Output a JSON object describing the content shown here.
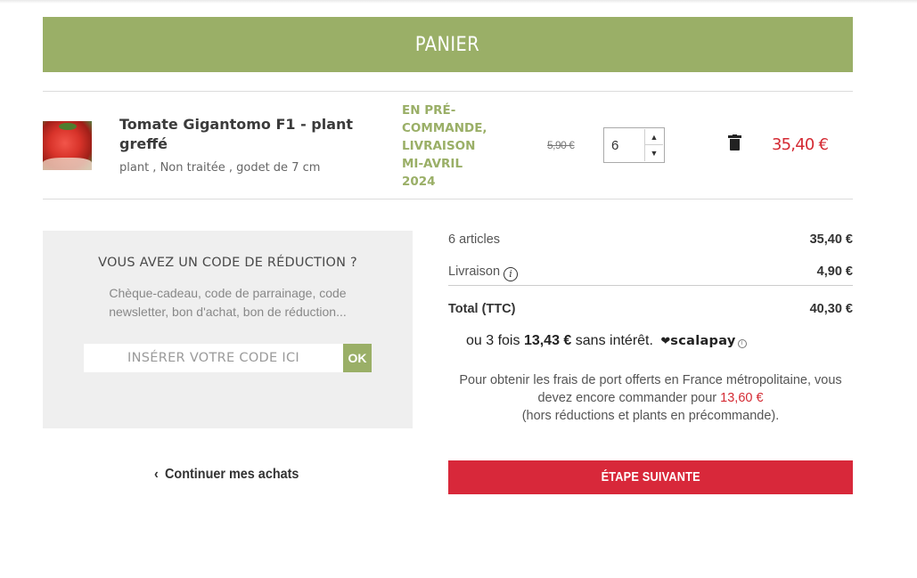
{
  "page": {
    "title": "PANIER"
  },
  "item": {
    "name": "Tomate Gigantomo F1 - plant greffé",
    "description": "plant , Non traitée , godet de 7 cm",
    "availability": "EN PRÉ-COMMANDE, LIVRAISON MI-AVRIL 2024",
    "unit_price": "5,90 €",
    "quantity": "6",
    "line_total": "35,40 €",
    "image_icon": "tomato-image"
  },
  "promo": {
    "title": "VOUS AVEZ UN CODE DE RÉDUCTION ?",
    "subtitle": "Chèque-cadeau, code de parrainage, code newsletter, bon d'achat, bon de réduction...",
    "placeholder": "INSÉRER VOTRE CODE ICI",
    "ok_label": "OK"
  },
  "summary": {
    "articles_label": "6 articles",
    "articles_amount": "35,40 €",
    "shipping_label": "Livraison",
    "shipping_amount": "4,90 €",
    "total_label": "Total (TTC)",
    "total_amount": "40,30 €"
  },
  "scalapay": {
    "prefix": "ou 3 fois",
    "amount": "13,43 €",
    "suffix": "sans intérêt.",
    "brand": "scalapay"
  },
  "free_shipping": {
    "text_before": "Pour obtenir les frais de port offerts en France métropolitaine, vous devez encore commander pour",
    "amount": "13,60 €",
    "text_after": "(hors réductions et plants en précommande)."
  },
  "actions": {
    "continue_label": "Continuer mes achats",
    "next_label": "ÉTAPE SUIVANTE"
  },
  "colors": {
    "accent_green": "#9aaf67",
    "accent_red": "#d8283a",
    "price_red": "#d42a33"
  }
}
